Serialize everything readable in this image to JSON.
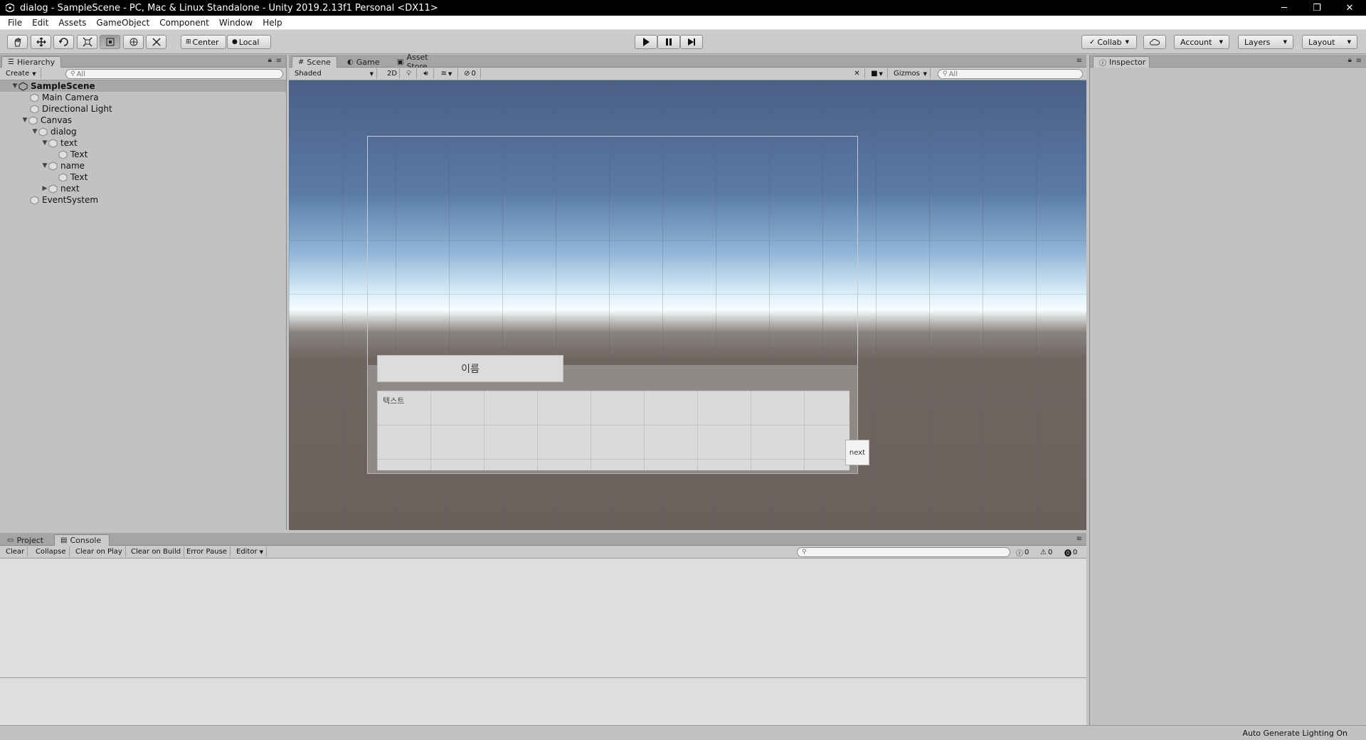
{
  "window": {
    "title": "dialog - SampleScene - PC, Mac & Linux Standalone - Unity 2019.2.13f1 Personal <DX11>",
    "minimize": "─",
    "restore": "❐",
    "close": "✕"
  },
  "menu": [
    "File",
    "Edit",
    "Assets",
    "GameObject",
    "Component",
    "Window",
    "Help"
  ],
  "toolbar": {
    "pivot_center": "Center",
    "pivot_local": "Local",
    "collab": "Collab",
    "account": "Account",
    "layers": "Layers",
    "layout": "Layout"
  },
  "hierarchy": {
    "tab": "Hierarchy",
    "create": "Create",
    "search_placeholder": "All",
    "items": [
      {
        "label": "SampleScene"
      },
      {
        "label": "Main Camera"
      },
      {
        "label": "Directional Light"
      },
      {
        "label": "Canvas"
      },
      {
        "label": "dialog"
      },
      {
        "label": "text"
      },
      {
        "label": "Text"
      },
      {
        "label": "name"
      },
      {
        "label": "Text"
      },
      {
        "label": "next"
      },
      {
        "label": "EventSystem"
      }
    ]
  },
  "scene": {
    "tabs": [
      "Scene",
      "Game",
      "Asset Store"
    ],
    "shading": "Shaded",
    "mode_2d": "2D",
    "hidden_count": "0",
    "gizmos": "Gizmos",
    "search_placeholder": "All",
    "name_text": "이름",
    "body_text": "텍스트",
    "next_text": "next"
  },
  "inspector": {
    "tab": "Inspector"
  },
  "console": {
    "tabs": [
      "Project",
      "Console"
    ],
    "buttons": [
      "Clear",
      "Collapse",
      "Clear on Play",
      "Clear on Build",
      "Error Pause",
      "Editor"
    ],
    "info_count": "0",
    "warn_count": "0",
    "error_count": "0"
  },
  "status": {
    "text": "Auto Generate Lighting On"
  },
  "colors": {
    "accent": "#3a72b0"
  }
}
